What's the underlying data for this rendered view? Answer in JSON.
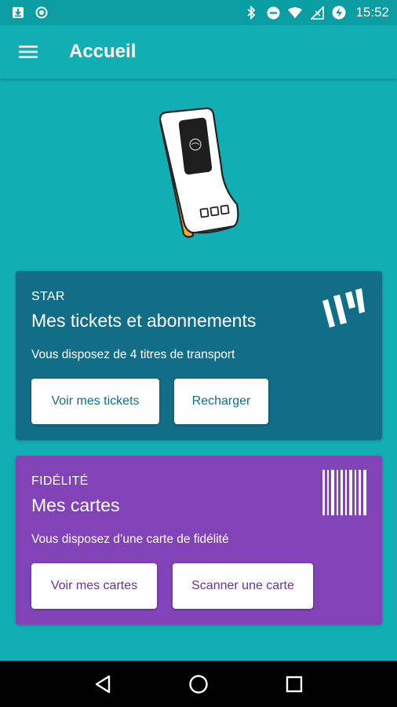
{
  "status_bar": {
    "time": "15:52",
    "icons_left": [
      "download-icon",
      "circle-record-icon"
    ],
    "icons_right": [
      "bluetooth-icon",
      "do-not-disturb-icon",
      "wifi-icon",
      "no-signal-icon",
      "battery-charging-icon"
    ]
  },
  "app_bar": {
    "title": "Accueil",
    "menu_icon": "hamburger-menu-icon"
  },
  "colors": {
    "background": "#11aeb3",
    "star_card": "#126d87",
    "fidelite_card": "#8243b8",
    "illustration_accent": "#f0a830"
  },
  "star_card": {
    "overline": "STAR",
    "title": "Mes tickets et abonnements",
    "description": "Vous disposez de 4 titres de transport",
    "buttons": {
      "tickets": "Voir mes tickets",
      "recharge": "Recharger"
    }
  },
  "fidelite_card": {
    "overline": "FIDÉLITÉ",
    "title": "Mes cartes",
    "description": "Vous disposez d’une carte de fidélité",
    "buttons": {
      "cartes": "Voir mes cartes",
      "scan": "Scanner une carte"
    }
  },
  "nav_bar": {
    "icons": [
      "back-triangle-icon",
      "home-circle-icon",
      "recents-square-icon"
    ]
  }
}
